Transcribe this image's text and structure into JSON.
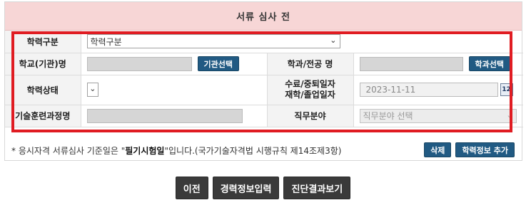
{
  "header": {
    "title": "서류 심사 전"
  },
  "form": {
    "edu_type": {
      "label": "학력구분",
      "selected": "학력구분"
    },
    "school": {
      "label": "학교(기관)명",
      "button": "기관선택"
    },
    "major": {
      "label": "학과/전공 명",
      "button": "학과선택"
    },
    "edu_status": {
      "label": "학력상태",
      "selected": ""
    },
    "date": {
      "label_line1": "수료/중퇴일자",
      "label_line2": "재학/졸업일자",
      "value": "2023-11-11",
      "icon_text": "12",
      "icon": "calendar-icon"
    },
    "training": {
      "label": "기술훈련과정명"
    },
    "job_field": {
      "label": "직무분야",
      "placeholder": "직무분야 선택"
    }
  },
  "note": {
    "prefix": "* 응시자격 서류심사 기준일은 \"",
    "bold": "필기시험일",
    "suffix": "\"입니다.(국가기술자격법 시행규칙 제14조제3항)"
  },
  "actions": {
    "delete": "삭제",
    "add": "학력정보 추가"
  },
  "nav": {
    "prev": "이전",
    "career": "경력정보입력",
    "result": "진단결과보기"
  },
  "colors": {
    "header_bg": "#f7d6d6",
    "accent_blue": "#215a83",
    "highlight_red": "#e01c22",
    "dark_button": "#3a3a3a"
  }
}
